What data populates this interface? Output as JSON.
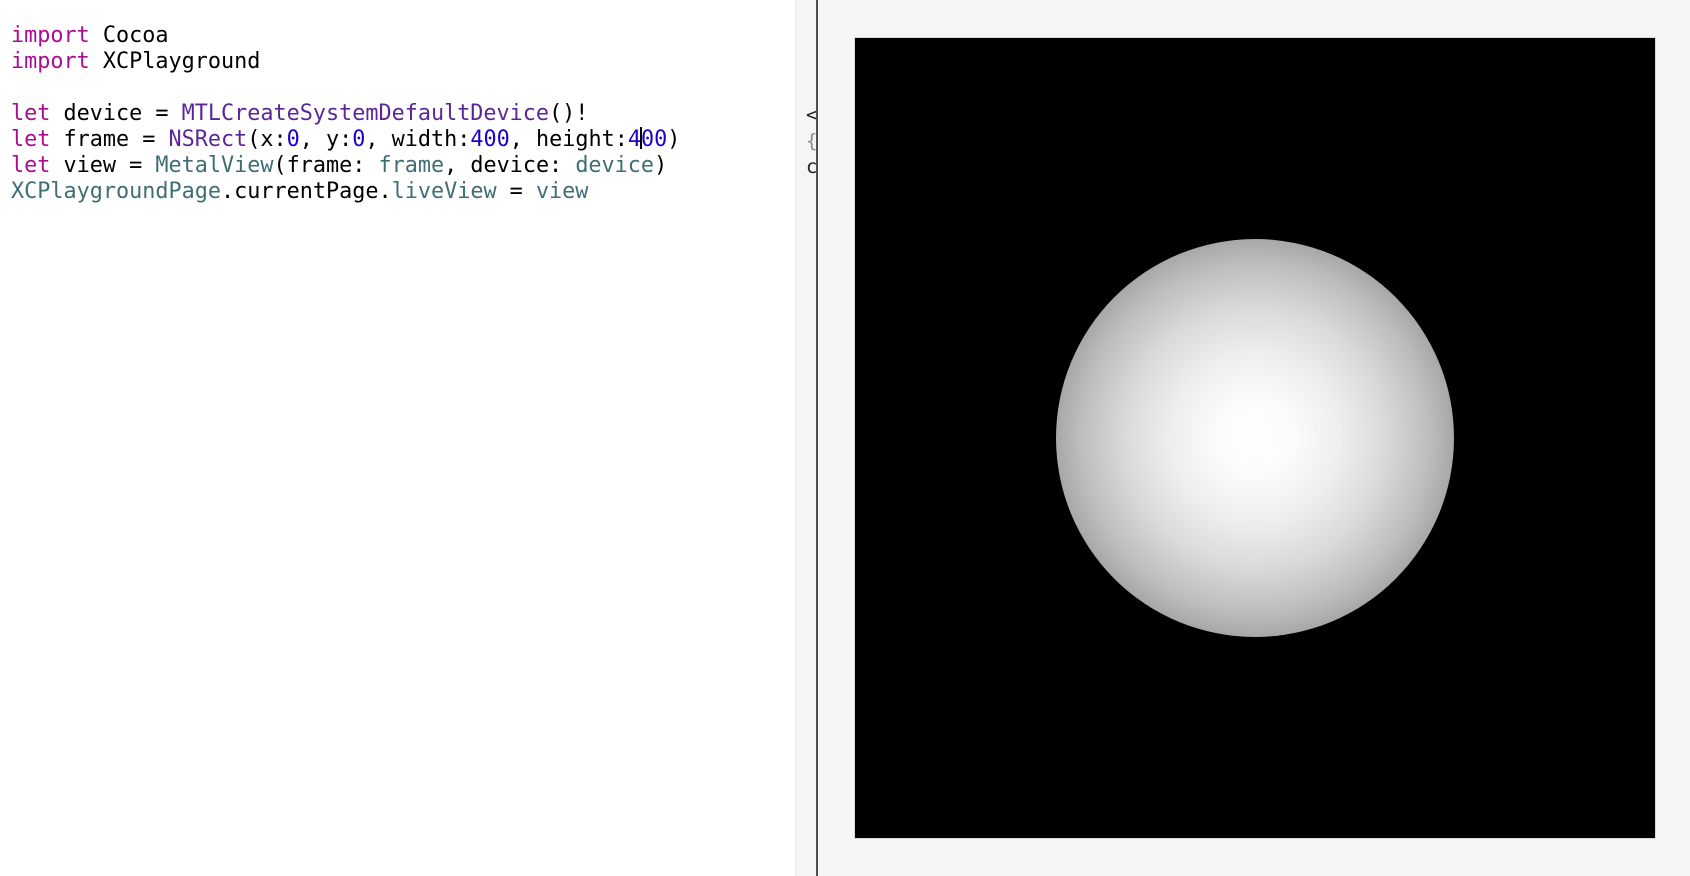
{
  "editor": {
    "lines": [
      [
        {
          "text": "import",
          "kind": "keyword"
        },
        {
          "text": " Cocoa",
          "kind": "plain"
        }
      ],
      [
        {
          "text": "import",
          "kind": "keyword"
        },
        {
          "text": " XCPlayground",
          "kind": "plain"
        }
      ],
      [],
      [
        {
          "text": "let",
          "kind": "keyword"
        },
        {
          "text": " device = ",
          "kind": "plain"
        },
        {
          "text": "MTLCreateSystemDefaultDevice",
          "kind": "type-system"
        },
        {
          "text": "()!",
          "kind": "plain"
        }
      ],
      [
        {
          "text": "let",
          "kind": "keyword"
        },
        {
          "text": " frame = ",
          "kind": "plain"
        },
        {
          "text": "NSRect",
          "kind": "type-system"
        },
        {
          "text": "(x:",
          "kind": "plain"
        },
        {
          "text": "0",
          "kind": "number"
        },
        {
          "text": ", y:",
          "kind": "plain"
        },
        {
          "text": "0",
          "kind": "number"
        },
        {
          "text": ", width:",
          "kind": "plain"
        },
        {
          "text": "400",
          "kind": "number"
        },
        {
          "text": ", height:",
          "kind": "plain"
        },
        {
          "text": "4",
          "kind": "number"
        },
        {
          "caret": true
        },
        {
          "text": "00",
          "kind": "number"
        },
        {
          "text": ")",
          "kind": "plain"
        }
      ],
      [
        {
          "text": "let",
          "kind": "keyword"
        },
        {
          "text": " view = ",
          "kind": "plain"
        },
        {
          "text": "MetalView",
          "kind": "type-project"
        },
        {
          "text": "(frame: ",
          "kind": "plain"
        },
        {
          "text": "frame",
          "kind": "type-project"
        },
        {
          "text": ", device: ",
          "kind": "plain"
        },
        {
          "text": "device",
          "kind": "type-project"
        },
        {
          "text": ")",
          "kind": "plain"
        }
      ],
      [
        {
          "text": "XCPlaygroundPage",
          "kind": "type-project"
        },
        {
          "text": ".currentPage.",
          "kind": "plain"
        },
        {
          "text": "liveView",
          "kind": "type-project"
        },
        {
          "text": " = ",
          "kind": "plain"
        },
        {
          "text": "view",
          "kind": "type-project"
        }
      ]
    ]
  },
  "results_sidebar": {
    "device_result": "<",
    "frame_result": "{",
    "view_result": "c"
  },
  "live_view": {
    "content": "shaded white sphere on black background"
  },
  "colors": {
    "keyword": "#aa0d91",
    "type_system": "#5c2699",
    "type_project": "#3f6e74",
    "number": "#1c00cf",
    "live_view_background": "#000000",
    "assistant_background": "#f6f6f6"
  }
}
